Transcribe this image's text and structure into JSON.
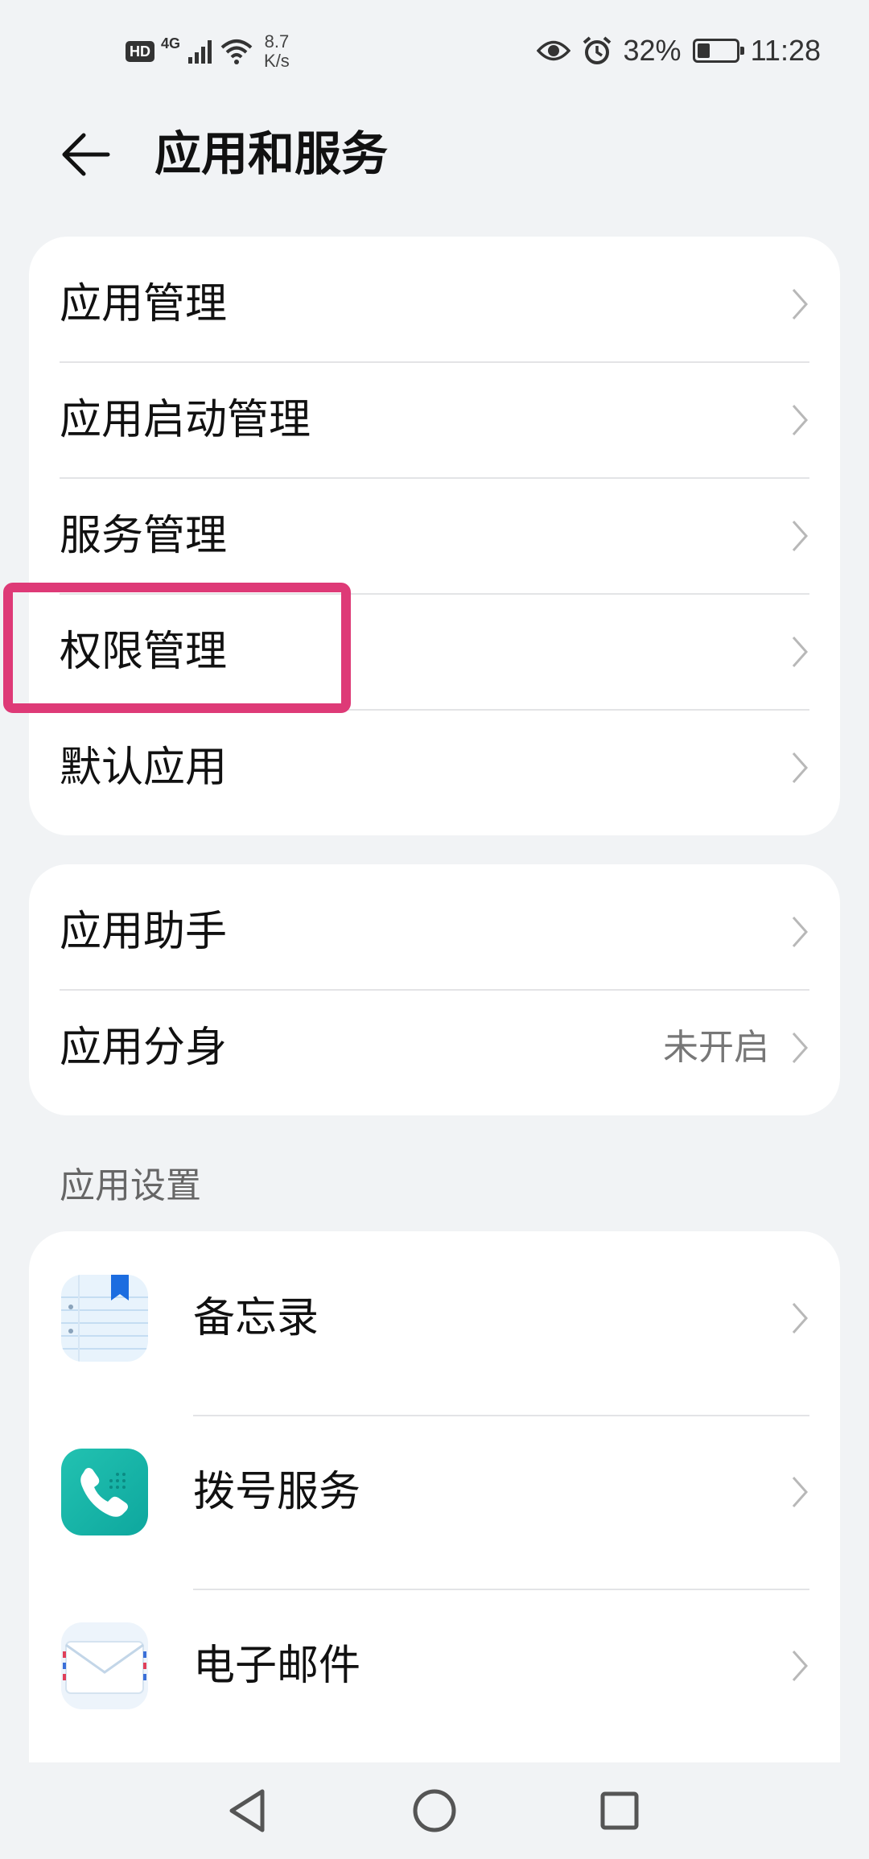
{
  "status_bar": {
    "hd": "HD",
    "network": "4G",
    "speed_value": "8.7",
    "speed_unit": "K/s",
    "battery": "32%",
    "battery_level": 0.32,
    "time": "11:28"
  },
  "header": {
    "title": "应用和服务"
  },
  "group1": {
    "items": [
      {
        "label": "应用管理"
      },
      {
        "label": "应用启动管理"
      },
      {
        "label": "服务管理"
      },
      {
        "label": "权限管理"
      },
      {
        "label": "默认应用"
      }
    ]
  },
  "group2": {
    "items": [
      {
        "label": "应用助手"
      },
      {
        "label": "应用分身",
        "value": "未开启"
      }
    ]
  },
  "app_settings": {
    "section_title": "应用设置",
    "apps": [
      {
        "label": "备忘录",
        "icon": "notepad-icon"
      },
      {
        "label": "拨号服务",
        "icon": "phone-icon"
      },
      {
        "label": "电子邮件",
        "icon": "mail-icon"
      }
    ]
  },
  "colors": {
    "background": "#f1f3f5",
    "card": "#ffffff",
    "highlight": "#de3a77",
    "dialer": "#14b5a8"
  }
}
